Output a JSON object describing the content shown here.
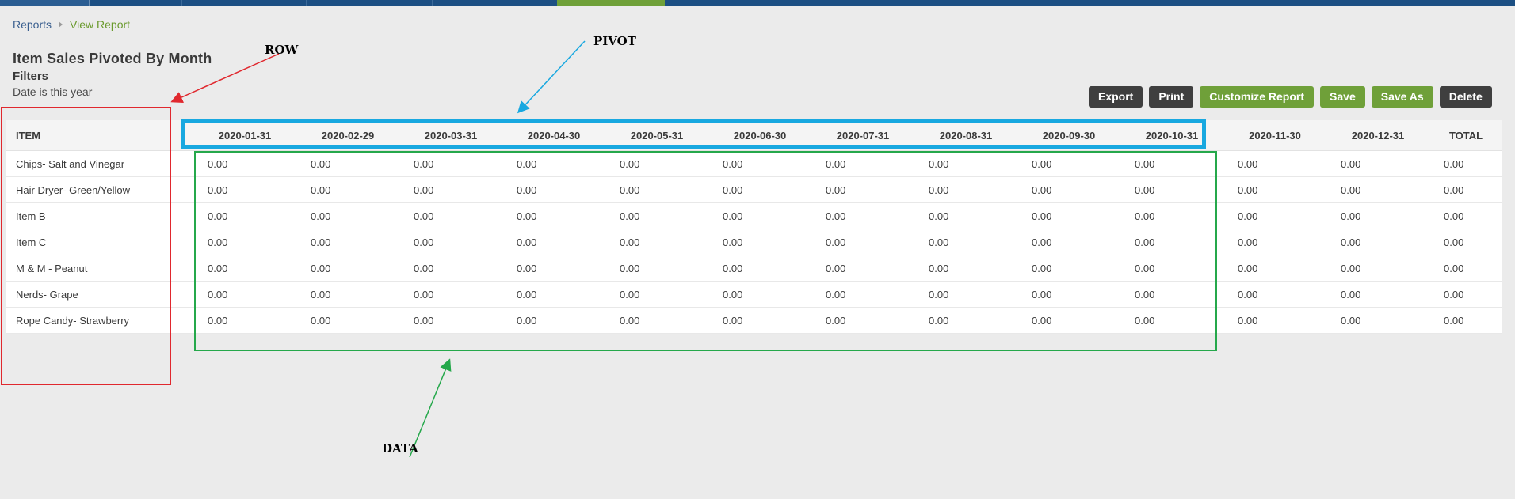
{
  "breadcrumb": {
    "root": "Reports",
    "current": "View Report"
  },
  "report": {
    "title": "Item Sales Pivoted By Month",
    "filters_label": "Filters",
    "filter_text": "Date is this year"
  },
  "toolbar": {
    "export": "Export",
    "print": "Print",
    "customize": "Customize Report",
    "save": "Save",
    "save_as": "Save As",
    "delete": "Delete"
  },
  "table": {
    "item_header": "ITEM",
    "columns": [
      "2020-01-31",
      "2020-02-29",
      "2020-03-31",
      "2020-04-30",
      "2020-05-31",
      "2020-06-30",
      "2020-07-31",
      "2020-08-31",
      "2020-09-30",
      "2020-10-31",
      "2020-11-30",
      "2020-12-31",
      "TOTAL"
    ],
    "rows": [
      {
        "item": "Chips- Salt and Vinegar",
        "values": [
          "0.00",
          "0.00",
          "0.00",
          "0.00",
          "0.00",
          "0.00",
          "0.00",
          "0.00",
          "0.00",
          "0.00",
          "0.00",
          "0.00",
          "0.00"
        ]
      },
      {
        "item": "Hair Dryer- Green/Yellow",
        "values": [
          "0.00",
          "0.00",
          "0.00",
          "0.00",
          "0.00",
          "0.00",
          "0.00",
          "0.00",
          "0.00",
          "0.00",
          "0.00",
          "0.00",
          "0.00"
        ]
      },
      {
        "item": "Item B",
        "values": [
          "0.00",
          "0.00",
          "0.00",
          "0.00",
          "0.00",
          "0.00",
          "0.00",
          "0.00",
          "0.00",
          "0.00",
          "0.00",
          "0.00",
          "0.00"
        ]
      },
      {
        "item": "Item C",
        "values": [
          "0.00",
          "0.00",
          "0.00",
          "0.00",
          "0.00",
          "0.00",
          "0.00",
          "0.00",
          "0.00",
          "0.00",
          "0.00",
          "0.00",
          "0.00"
        ]
      },
      {
        "item": "M & M - Peanut",
        "values": [
          "0.00",
          "0.00",
          "0.00",
          "0.00",
          "0.00",
          "0.00",
          "0.00",
          "0.00",
          "0.00",
          "0.00",
          "0.00",
          "0.00",
          "0.00"
        ]
      },
      {
        "item": "Nerds- Grape",
        "values": [
          "0.00",
          "0.00",
          "0.00",
          "0.00",
          "0.00",
          "0.00",
          "0.00",
          "0.00",
          "0.00",
          "0.00",
          "0.00",
          "0.00",
          "0.00"
        ]
      },
      {
        "item": "Rope Candy- Strawberry",
        "values": [
          "0.00",
          "0.00",
          "0.00",
          "0.00",
          "0.00",
          "0.00",
          "0.00",
          "0.00",
          "0.00",
          "0.00",
          "0.00",
          "0.00",
          "0.00"
        ]
      }
    ]
  },
  "annotations": {
    "row": "ROW",
    "pivot": "PIVOT",
    "data": "DATA"
  },
  "colors": {
    "nav_bar": "#1c4f83",
    "accent_green": "#6fa039",
    "button_dark": "#3f3f3f",
    "row_box": "#e0282e",
    "pivot_box": "#18a8e0",
    "data_box": "#25a84b"
  }
}
